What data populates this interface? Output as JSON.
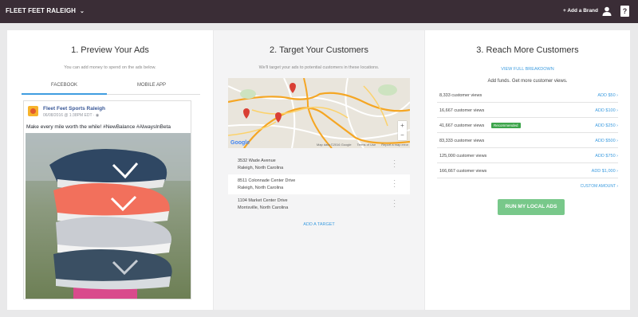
{
  "topbar": {
    "brand": "FLEET FEET RALEIGH",
    "add_brand": "+ Add a Brand",
    "help_glyph": "?"
  },
  "preview": {
    "title": "1. Preview Your Ads",
    "subtitle": "You can add money to spend on the ads below.",
    "tabs": [
      "FACEBOOK",
      "MOBILE APP"
    ],
    "active_tab": "FACEBOOK",
    "post": {
      "page_name": "Fleet Feet Sports Raleigh",
      "date": "06/08/2016 @ 1:38PM EDT · ",
      "text": "Make every mile worth the while! #NewBalance #AlwaysInBeta"
    }
  },
  "target": {
    "title": "2. Target Your Customers",
    "subtitle": "We'll target your ads to potential customers in these locations.",
    "map": {
      "attribution": [
        "Map data ©2016 Google",
        "Terms of Use",
        "Report a map error"
      ],
      "zoom_in": "+",
      "zoom_out": "−",
      "google": "Google"
    },
    "locations": [
      {
        "line1": "3532 Wade Avenue",
        "line2": "Raleigh, North Carolina"
      },
      {
        "line1": "8511 Colonnade Center Drive",
        "line2": "Raleigh, North Carolina"
      },
      {
        "line1": "1104 Market Center Drive",
        "line2": "Morrisville, North Carolina"
      }
    ],
    "add_target": "ADD A TARGET"
  },
  "reach": {
    "title": "3. Reach More Customers",
    "breakdown": "VIEW FULL BREAKDOWN",
    "subtitle": "Add funds. Get more customer views.",
    "rows": [
      {
        "views": "8,333 customer views",
        "action": "ADD $50 ›"
      },
      {
        "views": "16,667 customer views",
        "action": "ADD $100 ›"
      },
      {
        "views": "41,667 customer views",
        "action": "ADD $250 ›",
        "badge": "Recommended"
      },
      {
        "views": "83,333 customer views",
        "action": "ADD $500 ›"
      },
      {
        "views": "125,000 customer views",
        "action": "ADD $750 ›"
      },
      {
        "views": "166,667 customer views",
        "action": "ADD $1,000 ›"
      }
    ],
    "custom": "CUSTOM AMOUNT ›",
    "run_button": "RUN MY LOCAL ADS"
  },
  "colors": {
    "topbar": "#3a2d36",
    "link": "#3f9de0",
    "recommended": "#3da54b",
    "run_button": "#78c88a"
  }
}
